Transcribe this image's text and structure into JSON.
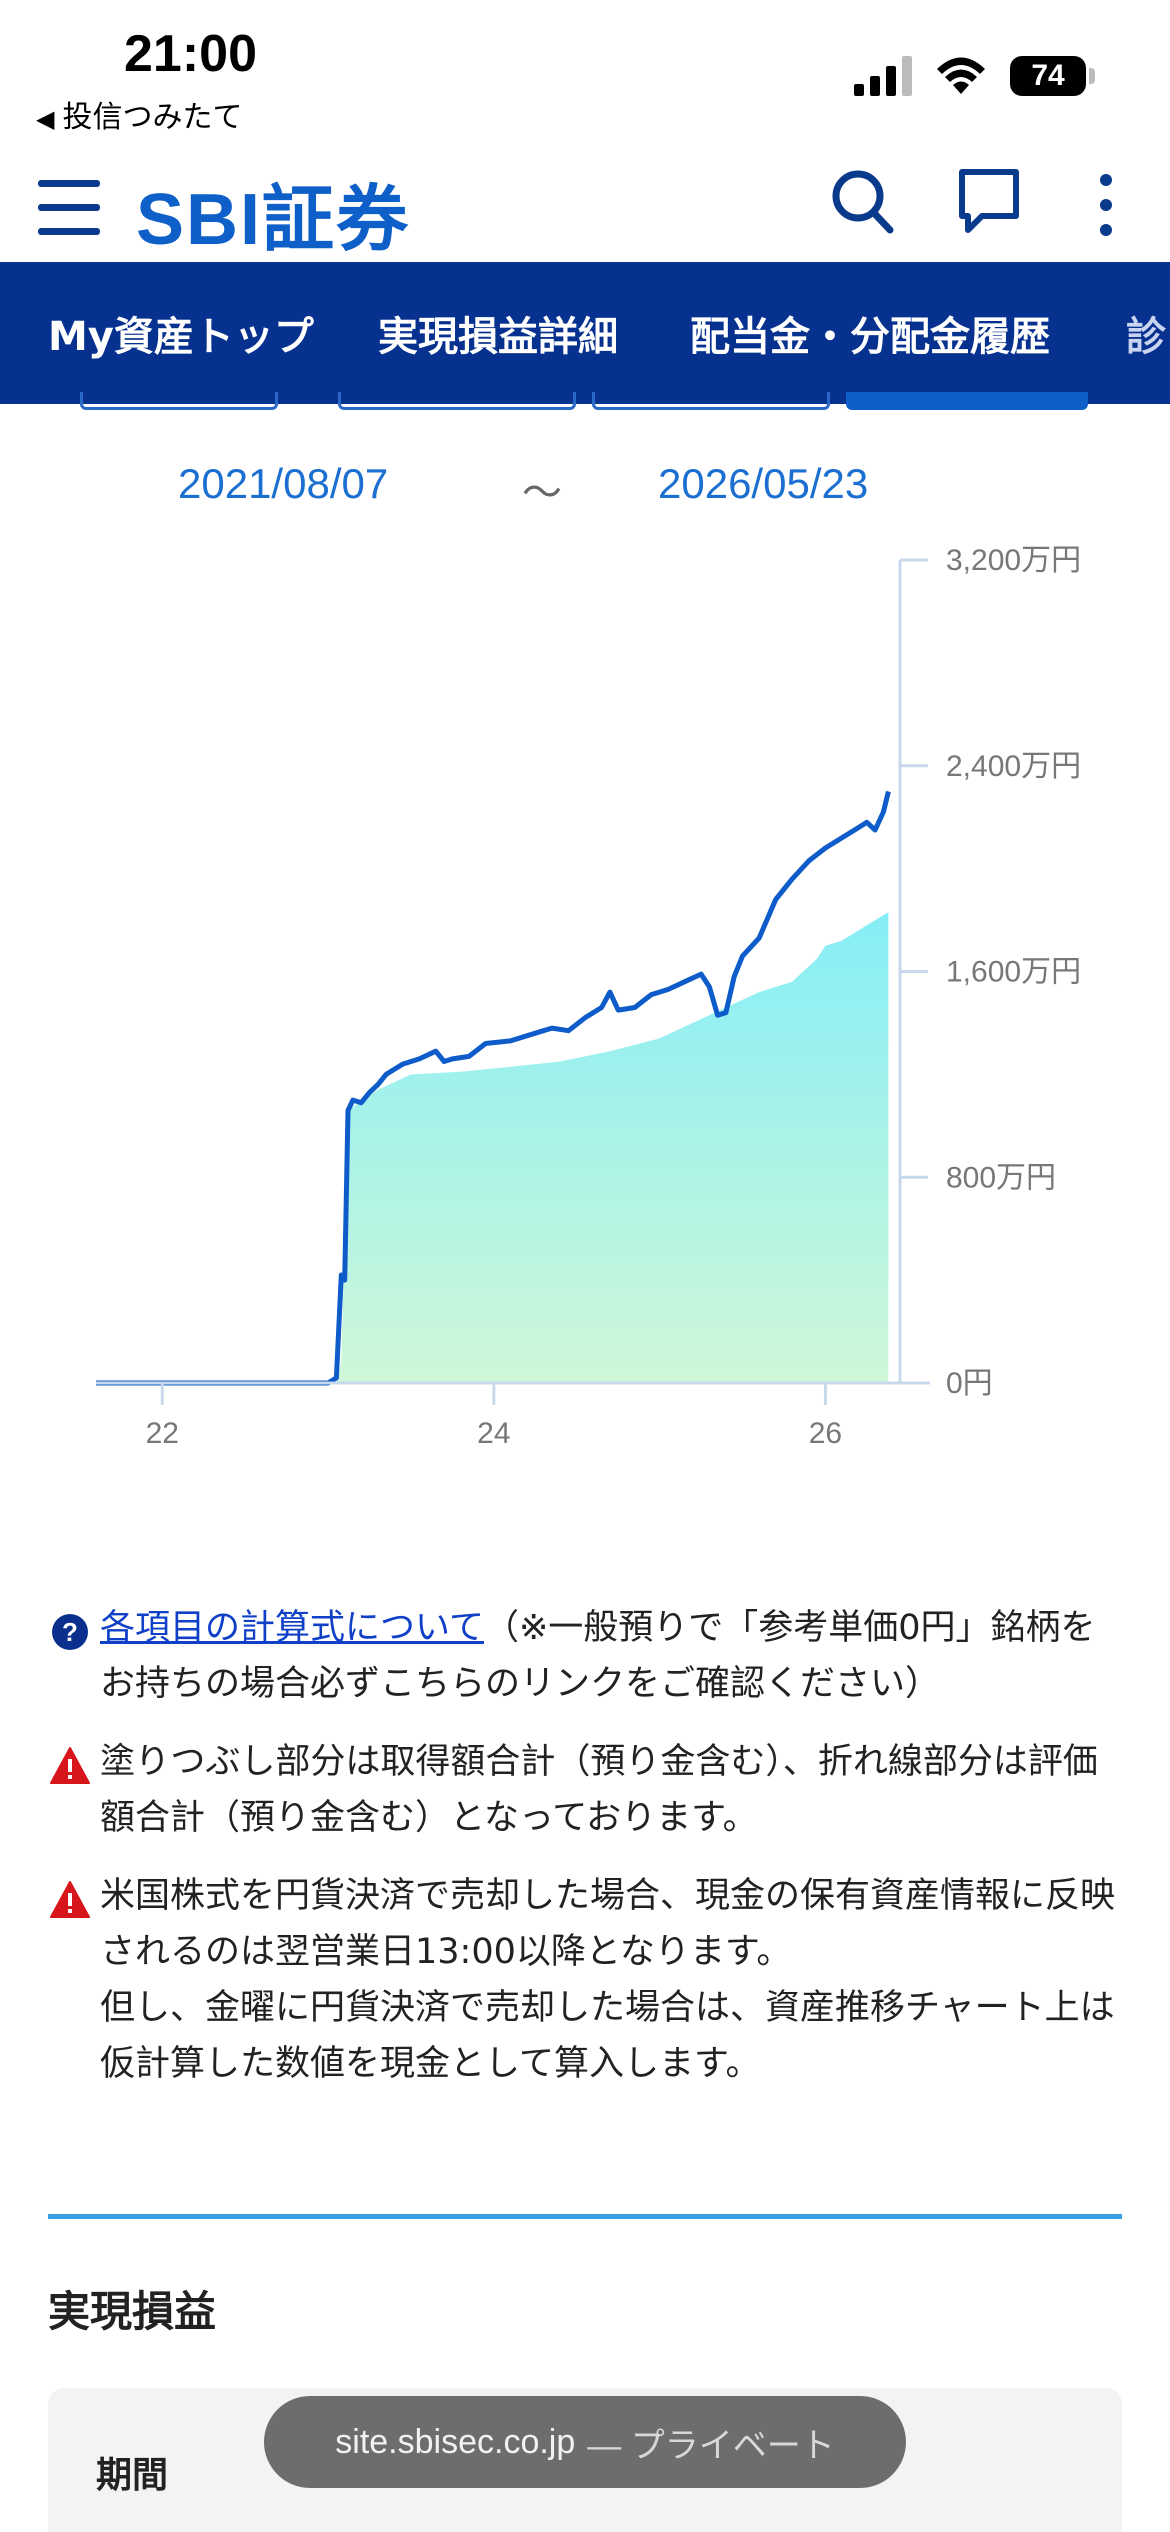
{
  "status_bar": {
    "time": "21:00",
    "back_app": "投信つみたて",
    "battery": "74"
  },
  "header": {
    "logo": "SBI証券",
    "icons": [
      "hamburger-menu-icon",
      "search-icon",
      "chat-icon",
      "more-vertical-icon"
    ]
  },
  "tabs": [
    {
      "label": "My資産トップ"
    },
    {
      "label": "実現損益詳細"
    },
    {
      "label": "配当金・分配金履歴"
    },
    {
      "label": "診"
    }
  ],
  "date_range": {
    "from": "2021/08/07",
    "separator": "〜",
    "to": "2026/05/23"
  },
  "chart_data": {
    "type": "area",
    "title": "",
    "y_axis_side": "right",
    "ylim": [
      0,
      32000000
    ],
    "y_ticks": [
      "3,200万円",
      "2,400万円",
      "1,600万円",
      "800万円",
      "0円"
    ],
    "x_ticks": [
      "22",
      "24",
      "26"
    ],
    "xlim": [
      2021.6,
      2026.45
    ],
    "series": [
      {
        "kind": "area",
        "color": "#8ef0f5",
        "points": [
          [
            2021.6,
            0
          ],
          [
            2023.05,
            0
          ],
          [
            2023.08,
            800000
          ],
          [
            2023.12,
            10600000
          ],
          [
            2023.3,
            11400000
          ],
          [
            2023.5,
            12000000
          ],
          [
            2023.8,
            12100000
          ],
          [
            2024.1,
            12300000
          ],
          [
            2024.4,
            12500000
          ],
          [
            2024.7,
            12900000
          ],
          [
            2025.0,
            13400000
          ],
          [
            2025.2,
            14000000
          ],
          [
            2025.4,
            14600000
          ],
          [
            2025.6,
            15200000
          ],
          [
            2025.8,
            15600000
          ],
          [
            2025.95,
            16500000
          ],
          [
            2026.0,
            17000000
          ],
          [
            2026.1,
            17200000
          ],
          [
            2026.2,
            17600000
          ],
          [
            2026.3,
            18000000
          ],
          [
            2026.38,
            18300000
          ]
        ]
      },
      {
        "kind": "line",
        "color": "#0d5cc9",
        "points": [
          [
            2021.6,
            0
          ],
          [
            2023.0,
            0
          ],
          [
            2023.05,
            200000
          ],
          [
            2023.08,
            4200000
          ],
          [
            2023.1,
            4000000
          ],
          [
            2023.12,
            10600000
          ],
          [
            2023.15,
            11000000
          ],
          [
            2023.2,
            10900000
          ],
          [
            2023.25,
            11300000
          ],
          [
            2023.3,
            11600000
          ],
          [
            2023.35,
            12000000
          ],
          [
            2023.45,
            12400000
          ],
          [
            2023.55,
            12600000
          ],
          [
            2023.65,
            12900000
          ],
          [
            2023.7,
            12500000
          ],
          [
            2023.75,
            12600000
          ],
          [
            2023.85,
            12700000
          ],
          [
            2023.95,
            13200000
          ],
          [
            2024.1,
            13300000
          ],
          [
            2024.25,
            13600000
          ],
          [
            2024.35,
            13800000
          ],
          [
            2024.45,
            13700000
          ],
          [
            2024.55,
            14200000
          ],
          [
            2024.65,
            14600000
          ],
          [
            2024.7,
            15200000
          ],
          [
            2024.75,
            14500000
          ],
          [
            2024.85,
            14600000
          ],
          [
            2024.95,
            15100000
          ],
          [
            2025.05,
            15300000
          ],
          [
            2025.15,
            15600000
          ],
          [
            2025.25,
            15900000
          ],
          [
            2025.3,
            15400000
          ],
          [
            2025.35,
            14300000
          ],
          [
            2025.4,
            14400000
          ],
          [
            2025.45,
            15800000
          ],
          [
            2025.5,
            16600000
          ],
          [
            2025.6,
            17300000
          ],
          [
            2025.7,
            18800000
          ],
          [
            2025.8,
            19600000
          ],
          [
            2025.9,
            20300000
          ],
          [
            2026.0,
            20800000
          ],
          [
            2026.1,
            21200000
          ],
          [
            2026.2,
            21600000
          ],
          [
            2026.25,
            21800000
          ],
          [
            2026.3,
            21500000
          ],
          [
            2026.35,
            22200000
          ],
          [
            2026.38,
            23000000
          ]
        ]
      }
    ]
  },
  "notes": [
    {
      "icon": "question-circle-icon",
      "link": "各項目の計算式について",
      "text": "（※一般預りで「参考単価0円」銘柄をお持ちの場合必ずこちらのリンクをご確認ください）"
    },
    {
      "icon": "warning-triangle-icon",
      "link": "",
      "text": "塗りつぶし部分は取得額合計（預り金含む）、折れ線部分は評価額合計（預り金含む）となっております。"
    },
    {
      "icon": "warning-triangle-icon",
      "link": "",
      "text": "米国株式を円貨決済で売却した場合、現金の保有資産情報に反映されるのは翌営業日13:00以降となります。",
      "text2": "但し、金曜に円貨決済で売却した場合は、資産推移チャート上は仮計算した数値を現金として算入します。"
    }
  ],
  "section": {
    "title": "実現損益",
    "period_label": "期間"
  },
  "url_bar": {
    "domain": "site.sbisec.co.jp",
    "mode": " — プライベート"
  }
}
